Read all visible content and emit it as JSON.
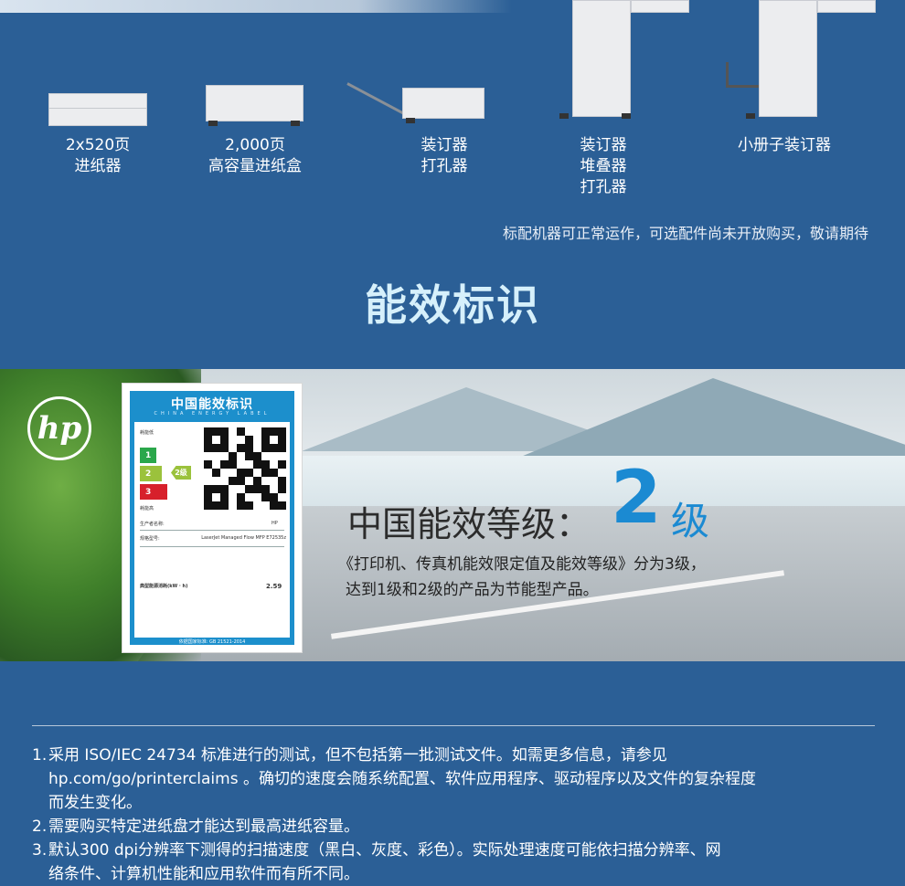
{
  "accessories": {
    "items": [
      {
        "label_line1": "2x520页",
        "label_line2": "进纸器",
        "label_line3": ""
      },
      {
        "label_line1": "2,000页",
        "label_line2": "高容量进纸盒",
        "label_line3": ""
      },
      {
        "label_line1": "装订器",
        "label_line2": "打孔器",
        "label_line3": ""
      },
      {
        "label_line1": "装订器",
        "label_line2": "堆叠器",
        "label_line3": "打孔器"
      },
      {
        "label_line1": "小册子装订器",
        "label_line2": "",
        "label_line3": ""
      }
    ],
    "availability_note": "标配机器可正常运作，可选配件尚未开放购买，敬请期待"
  },
  "energy_section": {
    "title": "能效标识",
    "brand_logo": "hp",
    "label": {
      "title": "中国能效标识",
      "subtitle": "CHINA ENERGY LABEL",
      "low_consumption": "耗能低",
      "high_consumption": "耗能高",
      "levels": [
        "1",
        "2",
        "3"
      ],
      "indicated_level": "2级",
      "manufacturer_label": "生产者名称:",
      "manufacturer_value": "HP",
      "model_label": "规格型号:",
      "model_value": "LaserJet Managed Flow MFP E72535z",
      "consumption_label": "典型能源消耗(kW · h)",
      "consumption_value": "2.59",
      "standard": "依据国家标准: GB 21521-2014"
    },
    "grade_prefix": "中国能效等级：",
    "grade_number": "2",
    "grade_unit": "级",
    "desc_line1": "《打印机、传真机能效限定值及能效等级》分为3级，",
    "desc_line2": "达到1级和2级的产品为节能型产品。"
  },
  "footnotes": [
    {
      "num": "1.",
      "lines": [
        "采用 ISO/IEC 24734 标准进行的测试，但不包括第一批测试文件。如需更多信息，请参见",
        "hp.com/go/printerclaims 。确切的速度会随系统配置、软件应用程序、驱动程序以及文件的复杂程度",
        "而发生变化。"
      ]
    },
    {
      "num": "2.",
      "lines": [
        "需要购买特定进纸盘才能达到最高进纸容量。"
      ]
    },
    {
      "num": "3.",
      "lines": [
        "默认300 dpi分辨率下测得的扫描速度（黑白、灰度、彩色）。实际处理速度可能依扫描分辨率、网",
        "络条件、计算机性能和应用软件而有所不同。"
      ]
    }
  ]
}
